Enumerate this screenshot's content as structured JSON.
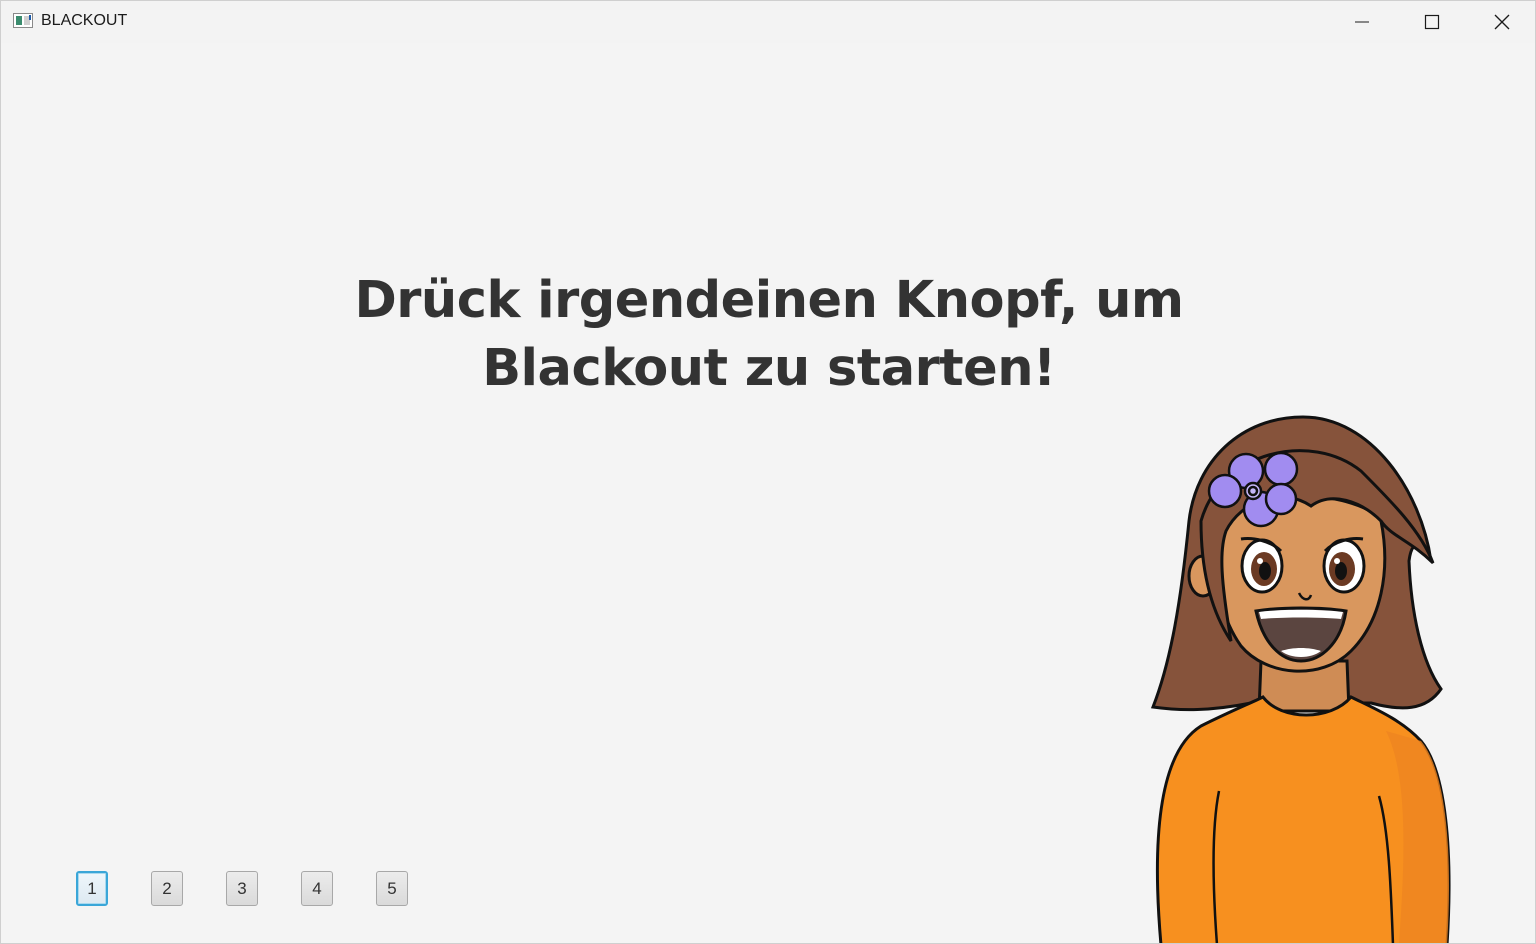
{
  "window": {
    "title": "BLACKOUT",
    "controls": {
      "minimize": "minimize-icon",
      "maximize": "maximize-icon",
      "close": "close-icon"
    }
  },
  "main": {
    "headline_line1": "Drück irgendeinen Knopf, um",
    "headline_line2": "Blackout zu starten!"
  },
  "buttons": [
    {
      "label": "1",
      "focused": true
    },
    {
      "label": "2",
      "focused": false
    },
    {
      "label": "3",
      "focused": false
    },
    {
      "label": "4",
      "focused": false
    },
    {
      "label": "5",
      "focused": false
    }
  ],
  "character": {
    "name": "girl-with-flower-illustration",
    "colors": {
      "hair": "#86533b",
      "skin": "#d9975e",
      "shirt": "#f7901f",
      "flower": "#a18cf0"
    }
  },
  "colors": {
    "background": "#f4f4f4",
    "text": "#333333",
    "focus_ring": "#3aa6d8"
  }
}
